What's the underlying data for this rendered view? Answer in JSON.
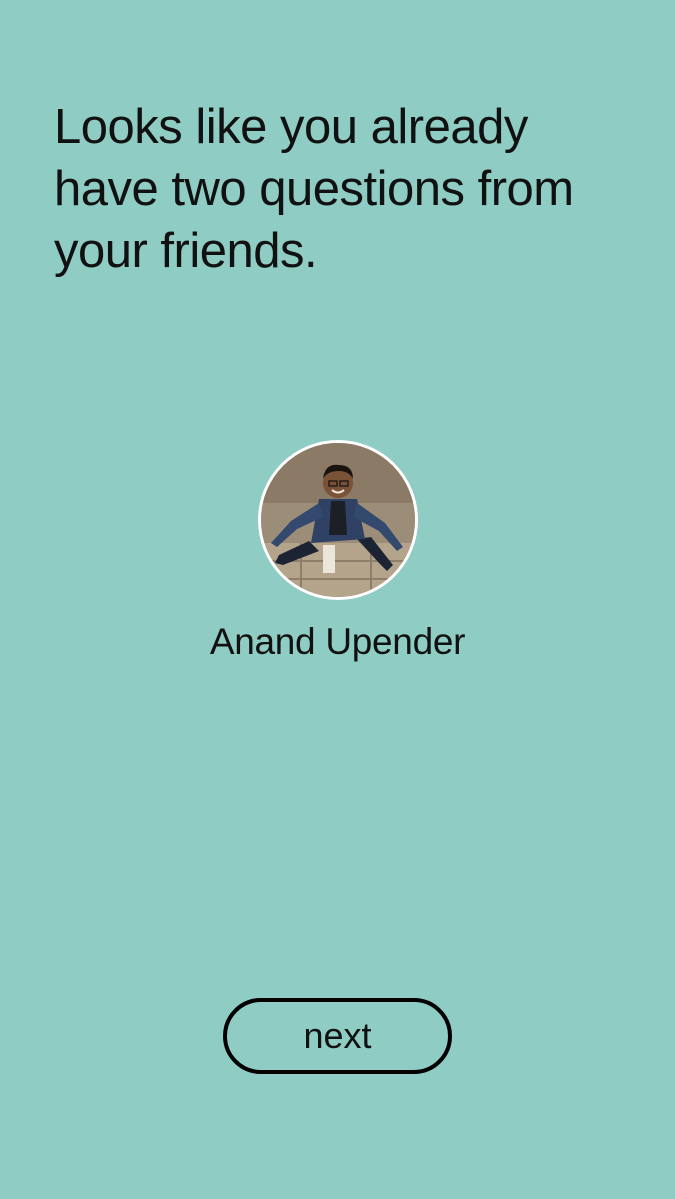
{
  "onboarding": {
    "headline": "Looks like you already have two questions from your friends."
  },
  "friend": {
    "name": "Anand Upender",
    "avatar_alt": "photo of friend"
  },
  "actions": {
    "next_label": "next"
  },
  "colors": {
    "background": "#8fccc3",
    "text": "#111111",
    "button_border": "#000000",
    "avatar_ring": "#ffffff"
  }
}
